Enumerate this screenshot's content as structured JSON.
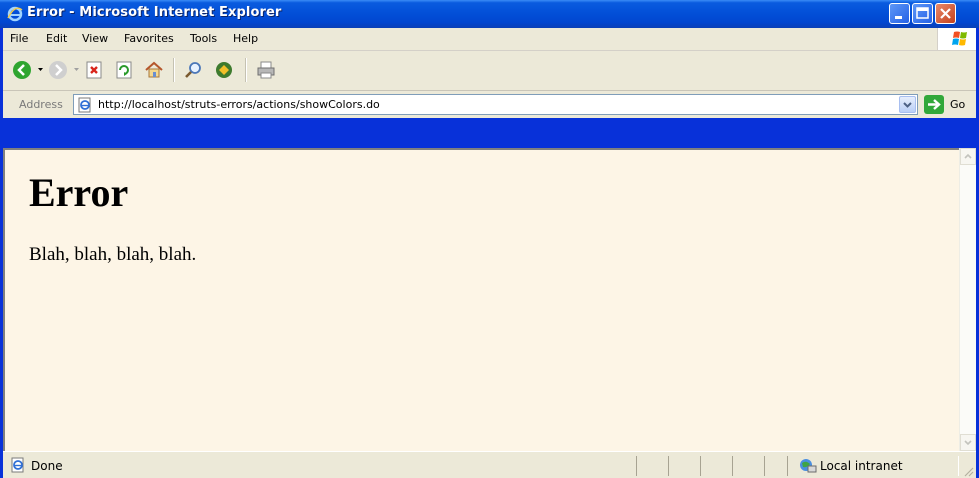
{
  "window": {
    "title": "Error - Microsoft Internet Explorer"
  },
  "menu": {
    "items": [
      "File",
      "Edit",
      "View",
      "Favorites",
      "Tools",
      "Help"
    ]
  },
  "toolbar": {
    "buttons": [
      "back-icon",
      "forward-icon",
      "stop-icon",
      "refresh-icon",
      "home-icon",
      "search-icon",
      "favorites-icon",
      "print-icon"
    ]
  },
  "address": {
    "label": "Address",
    "url": "http://localhost/struts-errors/actions/showColors.do",
    "go_label": "Go"
  },
  "page": {
    "heading": "Error",
    "body": "Blah, blah, blah, blah."
  },
  "status": {
    "text": "Done",
    "zone": "Local intranet"
  },
  "colors": {
    "title_bar": "#0350d8",
    "chrome": "#ece9d8",
    "page_background": "#fdf5e6"
  }
}
